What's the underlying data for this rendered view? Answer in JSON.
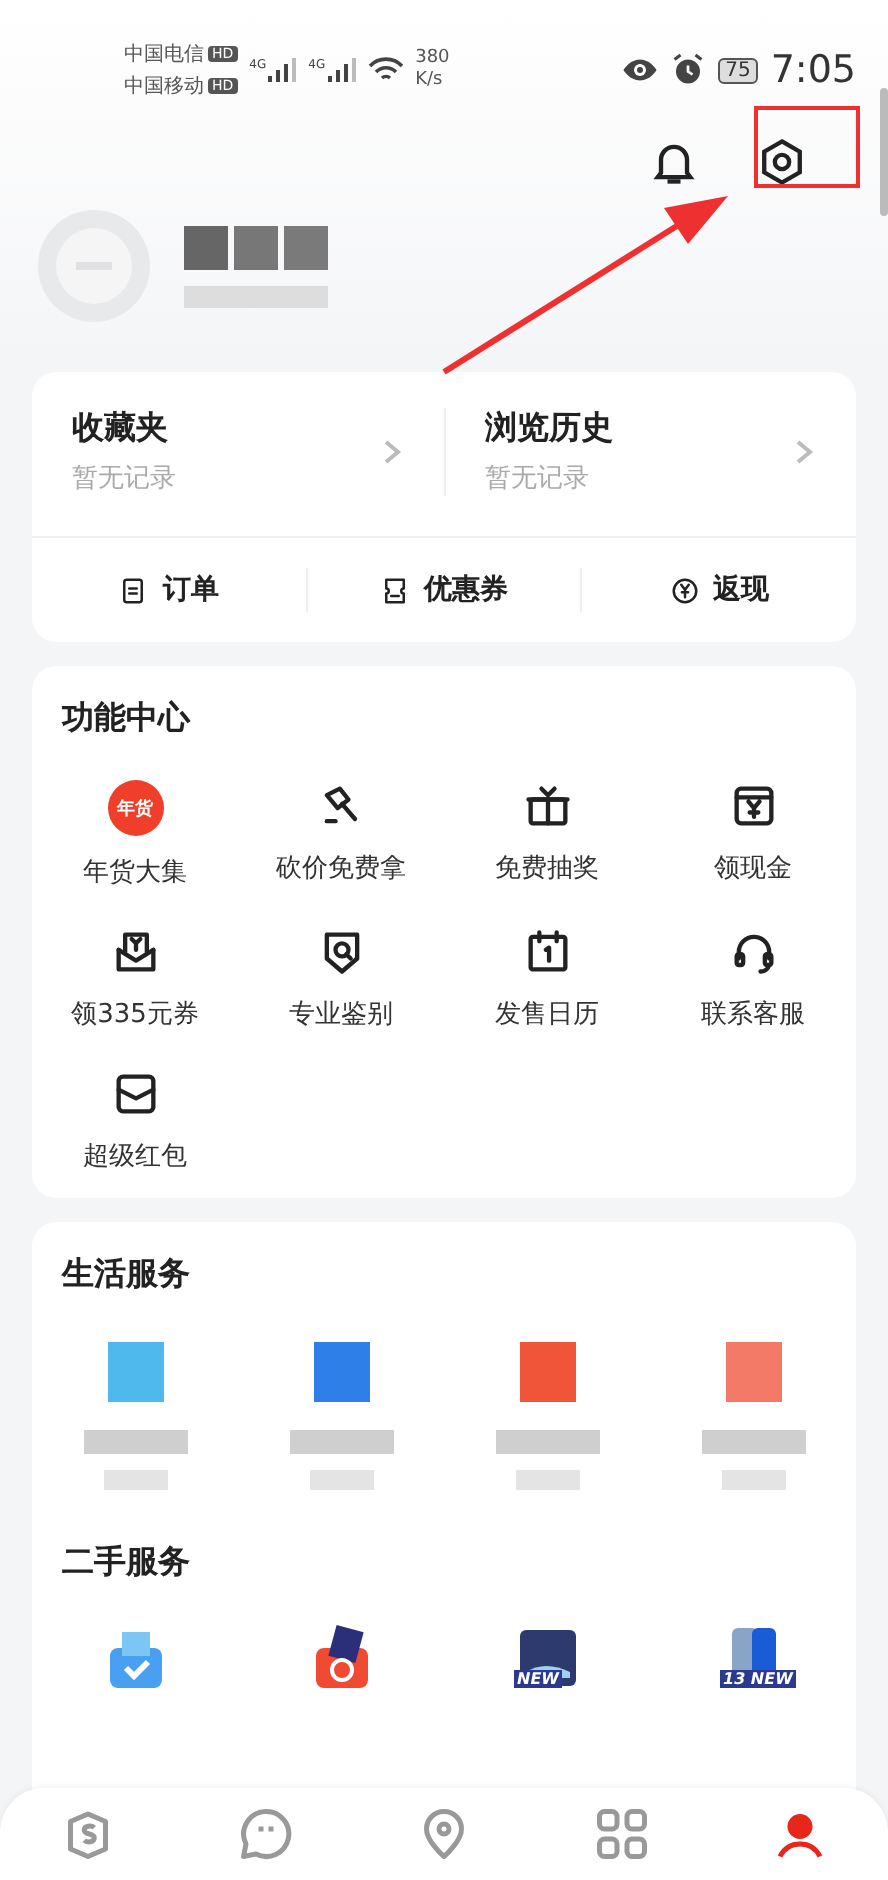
{
  "status_bar": {
    "carriers": [
      "中国电信",
      "中国移动"
    ],
    "carrier_badges": [
      "HD",
      "HD"
    ],
    "signals": [
      "4G",
      "4G"
    ],
    "speed_value": "380",
    "speed_unit": "K/s",
    "battery": "75",
    "time": "7:05"
  },
  "favorites_card": {
    "entries": [
      {
        "title": "收藏夹",
        "subtitle": "暂无记录"
      },
      {
        "title": "浏览历史",
        "subtitle": "暂无记录"
      }
    ],
    "shortcuts": [
      "订单",
      "优惠券",
      "返现"
    ]
  },
  "function_center": {
    "title": "功能中心",
    "items": [
      {
        "label": "年货大集",
        "badge": "年货"
      },
      {
        "label": "砍价免费拿"
      },
      {
        "label": "免费抽奖"
      },
      {
        "label": "领现金"
      },
      {
        "label": "领335元券"
      },
      {
        "label": "专业鉴别"
      },
      {
        "label": "发售日历"
      },
      {
        "label": "联系客服"
      },
      {
        "label": "超级红包"
      }
    ]
  },
  "life_services": {
    "title": "生活服务",
    "items": [
      {
        "color": "#4fb8ec"
      },
      {
        "color": "#2f7fe8"
      },
      {
        "color": "#f0553a"
      },
      {
        "color": "#f47a68"
      }
    ]
  },
  "second_hand": {
    "title": "二手服务",
    "items": [
      {
        "kind": "picture"
      },
      {
        "kind": "picture"
      },
      {
        "kind": "picture",
        "badge": "NEW"
      },
      {
        "kind": "picture",
        "badge": "13 NEW"
      }
    ]
  },
  "tab_bar": [
    {
      "selected": false
    },
    {
      "selected": false
    },
    {
      "selected": false
    },
    {
      "selected": false
    },
    {
      "selected": true
    }
  ]
}
